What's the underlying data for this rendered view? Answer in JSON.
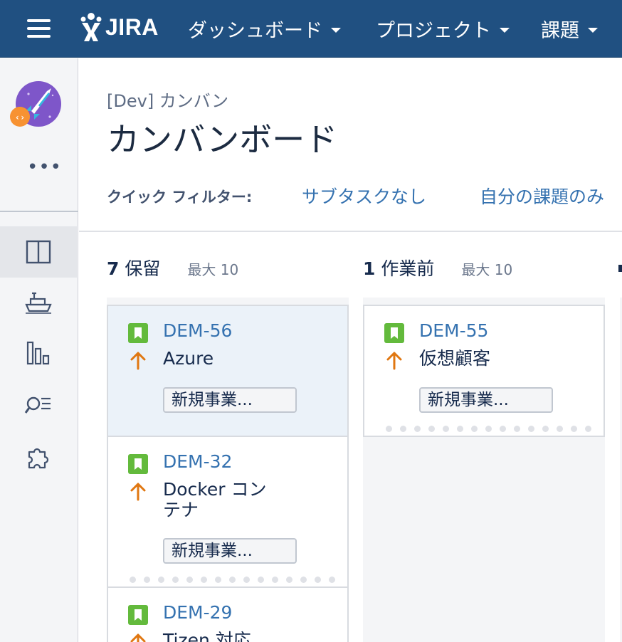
{
  "app": {
    "logo_text": "JIRA",
    "nav": [
      {
        "label": "ダッシュボード"
      },
      {
        "label": "プロジェクト"
      },
      {
        "label": "課題"
      }
    ]
  },
  "sidebar": {
    "more_label": "•••",
    "items": [
      {
        "icon": "board-icon"
      },
      {
        "icon": "releases-icon"
      },
      {
        "icon": "reports-icon"
      },
      {
        "icon": "issues-search-icon"
      },
      {
        "icon": "addons-puzzle-icon"
      }
    ]
  },
  "header": {
    "breadcrumb": "[Dev] カンバン",
    "title": "カンバンボード",
    "quick_filter_label": "クイック フィルター:",
    "quick_filters": [
      "サブタスクなし",
      "自分の課題のみ"
    ]
  },
  "columns": [
    {
      "count": "7",
      "name": "保留",
      "max": "最大 10",
      "cards": [
        {
          "key": "DEM-56",
          "summary": "Azure",
          "epic": "新規事業...",
          "selected": true
        },
        {
          "key": "DEM-32",
          "summary": "Docker コンテナ",
          "epic": "新規事業..."
        },
        {
          "key": "DEM-29",
          "summary": "Tizen 対応",
          "epic": ""
        }
      ]
    },
    {
      "count": "1",
      "name": "作業前",
      "max": "最大 10",
      "cards": [
        {
          "key": "DEM-55",
          "summary": "仮想顧客",
          "epic": "新規事業..."
        }
      ]
    }
  ],
  "colors": {
    "nav_bg": "#205081",
    "story_green": "#63ba3c",
    "priority_orange": "#e07711",
    "link_blue": "#3572b0"
  }
}
